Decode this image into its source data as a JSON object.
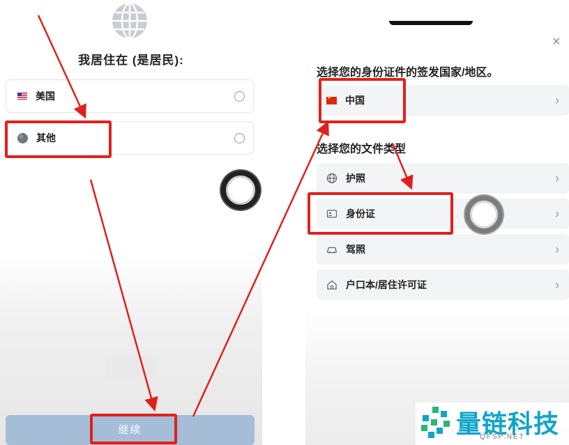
{
  "left_screen": {
    "title": "我居住在 (是居民):",
    "options": [
      {
        "label": "美国",
        "icon": "us-flag-icon"
      },
      {
        "label": "其他",
        "icon": "globe-icon"
      }
    ],
    "continue_label": "继续"
  },
  "right_screen": {
    "close_icon": "×",
    "country_title": "选择您的身份证件的签发国家/地区。",
    "country": {
      "label": "中国",
      "icon": "cn-flag-icon"
    },
    "doc_title": "选择您的文件类型",
    "doc_types": [
      {
        "label": "护照",
        "icon": "globe-icon"
      },
      {
        "label": "身份证",
        "icon": "id-card-icon"
      },
      {
        "label": "驾照",
        "icon": "car-icon"
      },
      {
        "label": "户口本/居住许可证",
        "icon": "home-icon"
      }
    ],
    "chevron": "›"
  },
  "watermark": {
    "brand": "量链科技",
    "site": "QFSP.NET"
  },
  "colors": {
    "annotation_red": "#e0201d",
    "continue_button": "#a6bdd7",
    "brand_cyan": "#0ea5c9"
  }
}
